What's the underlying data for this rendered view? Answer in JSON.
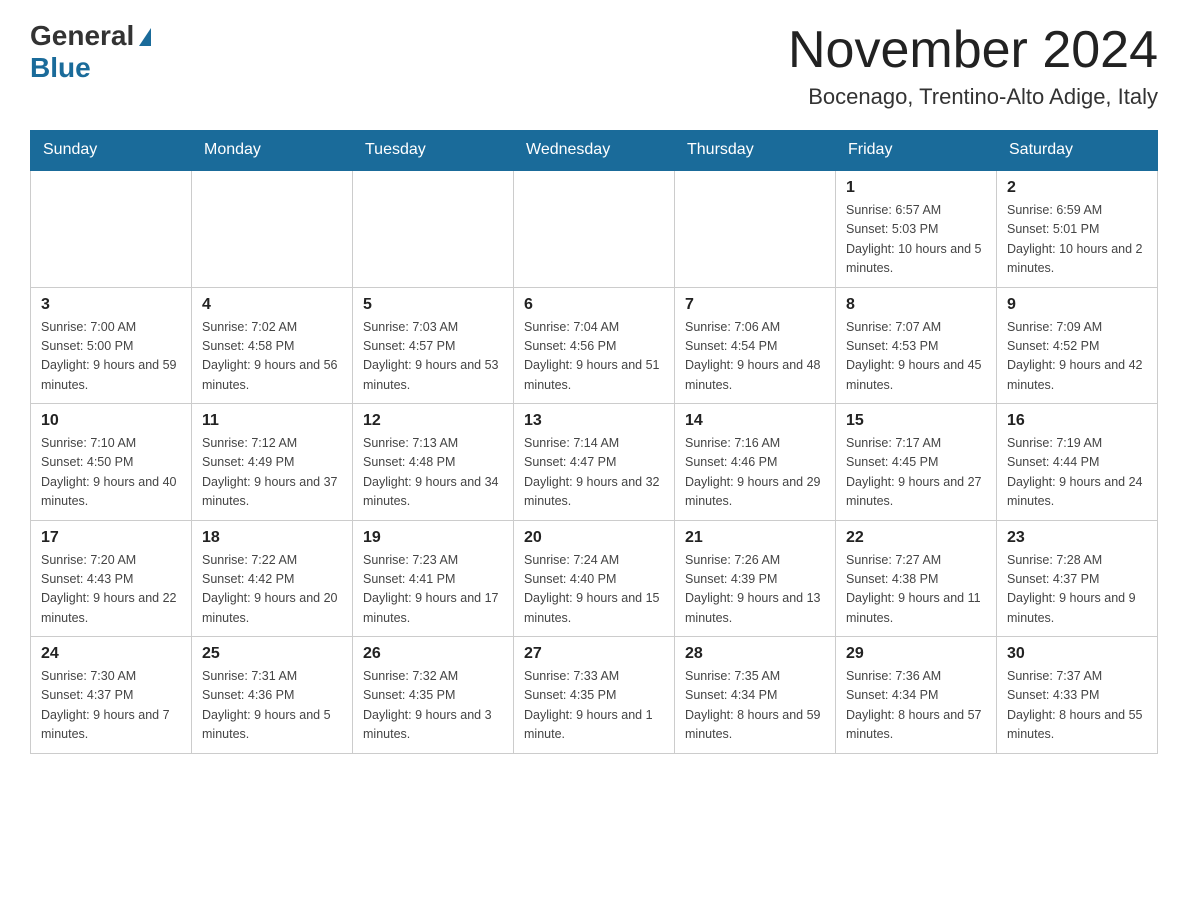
{
  "header": {
    "logo_text_general": "General",
    "logo_text_blue": "Blue",
    "title": "November 2024",
    "subtitle": "Bocenago, Trentino-Alto Adige, Italy"
  },
  "days_of_week": [
    "Sunday",
    "Monday",
    "Tuesday",
    "Wednesday",
    "Thursday",
    "Friday",
    "Saturday"
  ],
  "weeks": [
    [
      {
        "day": "",
        "info": ""
      },
      {
        "day": "",
        "info": ""
      },
      {
        "day": "",
        "info": ""
      },
      {
        "day": "",
        "info": ""
      },
      {
        "day": "",
        "info": ""
      },
      {
        "day": "1",
        "info": "Sunrise: 6:57 AM\nSunset: 5:03 PM\nDaylight: 10 hours and 5 minutes."
      },
      {
        "day": "2",
        "info": "Sunrise: 6:59 AM\nSunset: 5:01 PM\nDaylight: 10 hours and 2 minutes."
      }
    ],
    [
      {
        "day": "3",
        "info": "Sunrise: 7:00 AM\nSunset: 5:00 PM\nDaylight: 9 hours and 59 minutes."
      },
      {
        "day": "4",
        "info": "Sunrise: 7:02 AM\nSunset: 4:58 PM\nDaylight: 9 hours and 56 minutes."
      },
      {
        "day": "5",
        "info": "Sunrise: 7:03 AM\nSunset: 4:57 PM\nDaylight: 9 hours and 53 minutes."
      },
      {
        "day": "6",
        "info": "Sunrise: 7:04 AM\nSunset: 4:56 PM\nDaylight: 9 hours and 51 minutes."
      },
      {
        "day": "7",
        "info": "Sunrise: 7:06 AM\nSunset: 4:54 PM\nDaylight: 9 hours and 48 minutes."
      },
      {
        "day": "8",
        "info": "Sunrise: 7:07 AM\nSunset: 4:53 PM\nDaylight: 9 hours and 45 minutes."
      },
      {
        "day": "9",
        "info": "Sunrise: 7:09 AM\nSunset: 4:52 PM\nDaylight: 9 hours and 42 minutes."
      }
    ],
    [
      {
        "day": "10",
        "info": "Sunrise: 7:10 AM\nSunset: 4:50 PM\nDaylight: 9 hours and 40 minutes."
      },
      {
        "day": "11",
        "info": "Sunrise: 7:12 AM\nSunset: 4:49 PM\nDaylight: 9 hours and 37 minutes."
      },
      {
        "day": "12",
        "info": "Sunrise: 7:13 AM\nSunset: 4:48 PM\nDaylight: 9 hours and 34 minutes."
      },
      {
        "day": "13",
        "info": "Sunrise: 7:14 AM\nSunset: 4:47 PM\nDaylight: 9 hours and 32 minutes."
      },
      {
        "day": "14",
        "info": "Sunrise: 7:16 AM\nSunset: 4:46 PM\nDaylight: 9 hours and 29 minutes."
      },
      {
        "day": "15",
        "info": "Sunrise: 7:17 AM\nSunset: 4:45 PM\nDaylight: 9 hours and 27 minutes."
      },
      {
        "day": "16",
        "info": "Sunrise: 7:19 AM\nSunset: 4:44 PM\nDaylight: 9 hours and 24 minutes."
      }
    ],
    [
      {
        "day": "17",
        "info": "Sunrise: 7:20 AM\nSunset: 4:43 PM\nDaylight: 9 hours and 22 minutes."
      },
      {
        "day": "18",
        "info": "Sunrise: 7:22 AM\nSunset: 4:42 PM\nDaylight: 9 hours and 20 minutes."
      },
      {
        "day": "19",
        "info": "Sunrise: 7:23 AM\nSunset: 4:41 PM\nDaylight: 9 hours and 17 minutes."
      },
      {
        "day": "20",
        "info": "Sunrise: 7:24 AM\nSunset: 4:40 PM\nDaylight: 9 hours and 15 minutes."
      },
      {
        "day": "21",
        "info": "Sunrise: 7:26 AM\nSunset: 4:39 PM\nDaylight: 9 hours and 13 minutes."
      },
      {
        "day": "22",
        "info": "Sunrise: 7:27 AM\nSunset: 4:38 PM\nDaylight: 9 hours and 11 minutes."
      },
      {
        "day": "23",
        "info": "Sunrise: 7:28 AM\nSunset: 4:37 PM\nDaylight: 9 hours and 9 minutes."
      }
    ],
    [
      {
        "day": "24",
        "info": "Sunrise: 7:30 AM\nSunset: 4:37 PM\nDaylight: 9 hours and 7 minutes."
      },
      {
        "day": "25",
        "info": "Sunrise: 7:31 AM\nSunset: 4:36 PM\nDaylight: 9 hours and 5 minutes."
      },
      {
        "day": "26",
        "info": "Sunrise: 7:32 AM\nSunset: 4:35 PM\nDaylight: 9 hours and 3 minutes."
      },
      {
        "day": "27",
        "info": "Sunrise: 7:33 AM\nSunset: 4:35 PM\nDaylight: 9 hours and 1 minute."
      },
      {
        "day": "28",
        "info": "Sunrise: 7:35 AM\nSunset: 4:34 PM\nDaylight: 8 hours and 59 minutes."
      },
      {
        "day": "29",
        "info": "Sunrise: 7:36 AM\nSunset: 4:34 PM\nDaylight: 8 hours and 57 minutes."
      },
      {
        "day": "30",
        "info": "Sunrise: 7:37 AM\nSunset: 4:33 PM\nDaylight: 8 hours and 55 minutes."
      }
    ]
  ]
}
